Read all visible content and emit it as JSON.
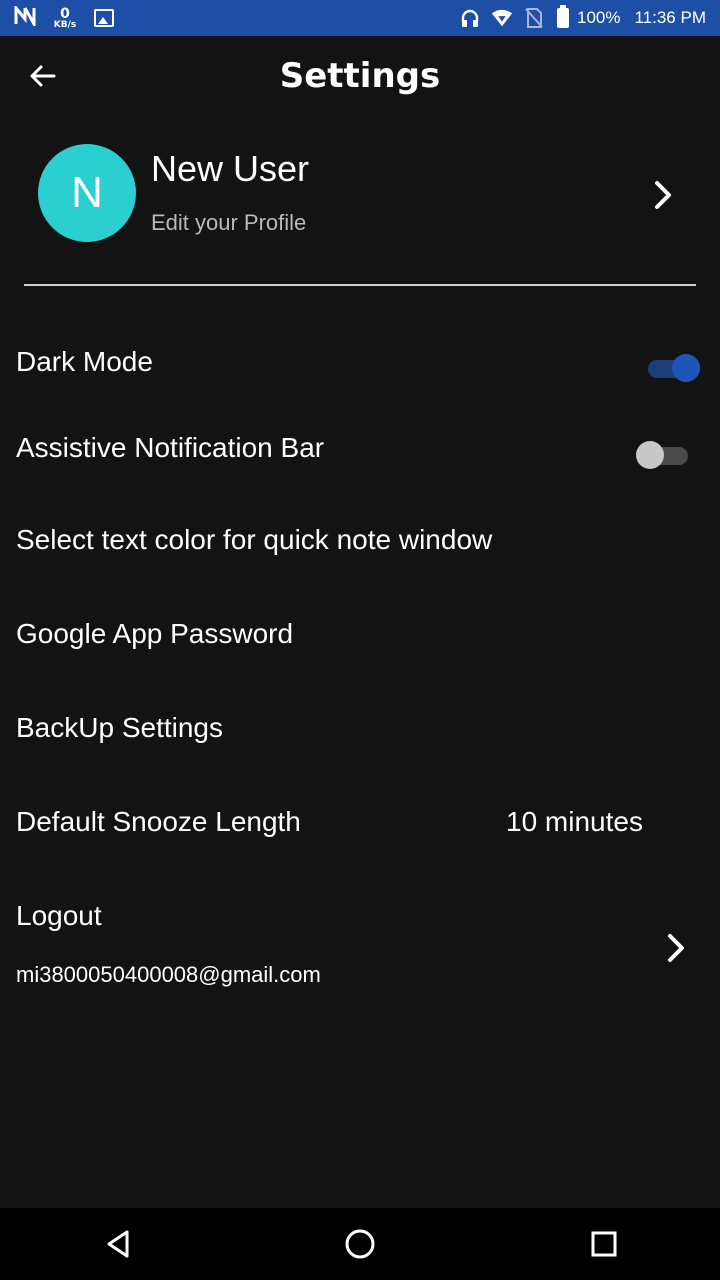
{
  "status_bar": {
    "net_speed_value": "0",
    "net_speed_unit": "KB/s",
    "battery_percent": "100%",
    "time": "11:36 PM",
    "background_color": "#1e4fa6"
  },
  "header": {
    "title": "Settings",
    "back_icon": "arrow-left-icon"
  },
  "profile": {
    "avatar_letter": "N",
    "avatar_color": "#2bcfcf",
    "name": "New User",
    "subtitle": "Edit your Profile"
  },
  "settings": {
    "dark_mode": {
      "label": "Dark Mode",
      "enabled": true
    },
    "assistive_bar": {
      "label": "Assistive Notification Bar",
      "enabled": false
    },
    "text_color": {
      "label": "Select text color for quick note window"
    },
    "google_password": {
      "label": "Google App Password"
    },
    "backup": {
      "label": "BackUp Settings"
    },
    "snooze": {
      "label": "Default Snooze Length",
      "value": "10 minutes"
    },
    "logout": {
      "label": "Logout",
      "email": "mi3800050400008@gmail.com"
    }
  },
  "colors": {
    "background": "#131313",
    "toggle_on": "#1e56b7",
    "toggle_off": "#c8c8c8"
  }
}
